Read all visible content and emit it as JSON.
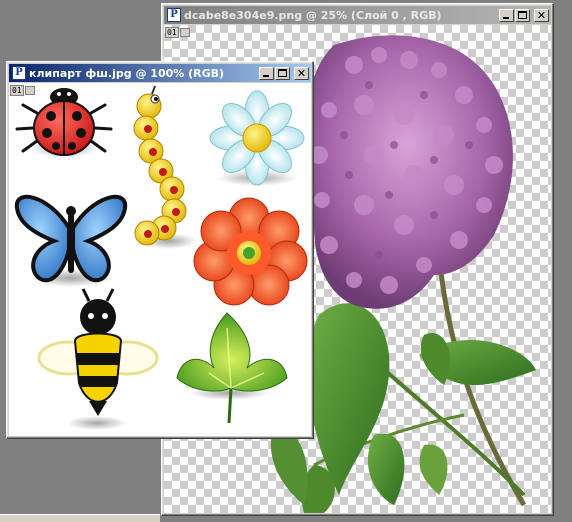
{
  "back_window": {
    "title": "dcabe8e304e9.png @ 25% (Слой 0 , RGB)",
    "layer_number": "01",
    "icon_glyph": "P"
  },
  "front_window": {
    "title": "клипарт фш.jpg @ 100% (RGB)",
    "layer_number": "01",
    "icon_glyph": "P"
  },
  "window_controls": {
    "close_glyph": "✕"
  },
  "clipart_items": [
    "ladybug-icon",
    "caterpillar-icon",
    "daisy-icon",
    "butterfly-icon",
    "red-flower-icon",
    "bee-icon",
    "leaf-icon"
  ],
  "colors": {
    "active_title": "#0a246a",
    "inactive_title": "#808080",
    "lilac": "#b06fb6",
    "leaf": "#3f8c2a"
  }
}
